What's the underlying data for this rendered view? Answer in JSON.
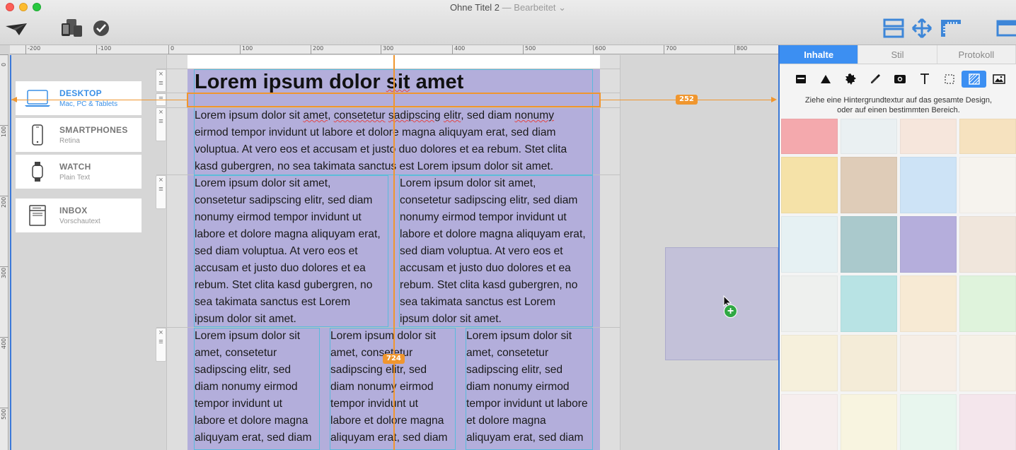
{
  "window": {
    "title": "Ohne Titel 2",
    "edited": " — Bearbeitet ⌄"
  },
  "toolbar": {
    "send_icon": "paper-plane-icon",
    "devices_icon": "devices-icon",
    "check_icon": "checkmark-icon",
    "layout_icon": "layout-icon",
    "move_icon": "move-arrows-icon",
    "ruler_icon": "ruler-icon",
    "panel_icon": "panel-icon"
  },
  "ruler_h": [
    "-200",
    "-100",
    "0",
    "100",
    "200",
    "300",
    "400",
    "500",
    "600",
    "700",
    "800"
  ],
  "ruler_v": [
    "0",
    "100",
    "200",
    "300",
    "400",
    "500"
  ],
  "devices": [
    {
      "title": "DESKTOP",
      "sub": "Mac, PC & Tablets",
      "icon": "laptop-icon"
    },
    {
      "title": "SMARTPHONES",
      "sub": "Retina",
      "icon": "smartphone-icon"
    },
    {
      "title": "WATCH",
      "sub": "Plain Text",
      "icon": "watch-icon"
    },
    {
      "title": "INBOX",
      "sub": "Vorschautext",
      "icon": "inbox-icon"
    }
  ],
  "handles": {
    "close": "×",
    "menu": "≡"
  },
  "content": {
    "headline": "Lorem ipsum dolor sit amet",
    "para1": [
      "Lorem ipsum dolor sit amet, consetetur sadipscing elitr, sed diam nonumy",
      "eirmod tempor invidunt ut labore et dolore magna aliquyam erat, sed diam",
      "voluptua. At vero eos et accusam et justo duo dolores et ea rebum. Stet clita",
      "kasd gubergren, no sea takimata sanctus est Lorem ipsum dolor sit amet."
    ],
    "col2": [
      "Lorem ipsum dolor sit amet,",
      "consetetur sadipscing elitr, sed diam",
      "nonumy eirmod tempor invidunt ut",
      "labore et dolore magna aliquyam erat,",
      "sed diam voluptua. At vero eos et",
      "accusam et justo duo dolores et ea",
      "rebum. Stet clita kasd gubergren, no",
      "sea takimata sanctus est Lorem",
      "ipsum dolor sit amet."
    ],
    "col3": [
      "Lorem ipsum dolor sit",
      "amet, consetetur",
      "sadipscing elitr, sed",
      "diam nonumy eirmod",
      "tempor invidunt ut",
      "labore et dolore magna",
      "aliquyam erat, sed diam"
    ],
    "col3c": [
      "Lorem ipsum dolor sit",
      "amet, consetetur",
      "sadipscing elitr, sed",
      "diam nonumy eirmod",
      "tempor invidunt ut labore",
      "et dolore magna",
      "aliquyam erat, sed diam"
    ]
  },
  "guides": {
    "width_badge": "724",
    "offset_badge": "252"
  },
  "panel": {
    "tabs": [
      "Inhalte",
      "Stil",
      "Protokoll"
    ],
    "tool_icons": [
      "mail-block-icon",
      "triangle-icon",
      "badge-icon",
      "eyedropper-icon",
      "video-icon",
      "text-icon",
      "selection-icon",
      "texture-icon",
      "image-icon"
    ],
    "hint_line1": "Ziehe eine Hintergrundtextur auf das gesamte Design,",
    "hint_line2": "oder auf einen bestimmten Bereich.",
    "swatches": [
      "#f4a9ad",
      "#eaf0f2",
      "#f6e6dc",
      "#f6e2bf",
      "#f5e2a8",
      "#dfccb8",
      "#cde3f6",
      "#f6f3ee",
      "#e6f1f3",
      "#aac9cc",
      "#b5aedc",
      "#f0e6dc",
      "#eef0ee",
      "#b8e3e4",
      "#f7ead4",
      "#dff3dc",
      "#f6f0dc",
      "#f4ecd8",
      "#f6eee6",
      "#f6f1e7",
      "#f6eeee",
      "#f8f4e0",
      "#e8f6ee",
      "#f4e6ec"
    ]
  }
}
